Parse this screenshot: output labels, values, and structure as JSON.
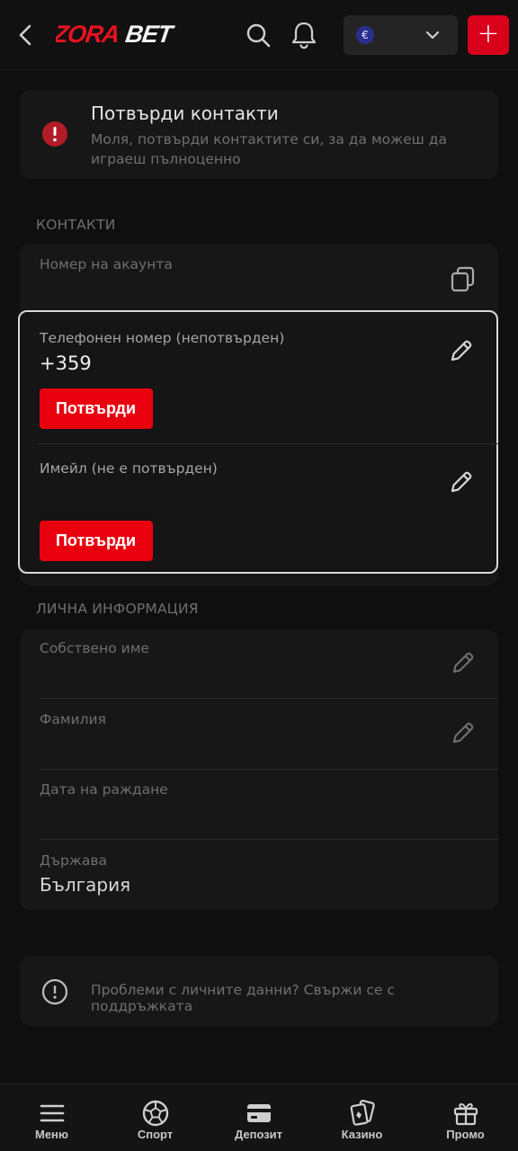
{
  "header": {
    "logo_text": "ZORABET",
    "currency_symbol": "€",
    "deposit_symbol": "+"
  },
  "alert": {
    "title": "Потвърди контакти",
    "text": "Моля, потвърди контактите си, за да можеш да играеш пълноценно"
  },
  "contacts": {
    "section_title": "КОНТАКТИ",
    "account_label": "Номер на акаунта",
    "phone_label": "Телефонен номер (непотвърден)",
    "phone_value": "+359",
    "phone_confirm": "Потвърди",
    "email_label": "Имейл (не е потвърден)",
    "email_confirm": "Потвърди"
  },
  "personal": {
    "section_title": "ЛИЧНА ИНФОРМАЦИЯ",
    "first_name_label": "Собствено име",
    "last_name_label": "Фамилия",
    "birthdate_label": "Дата на раждане",
    "country_label": "Държава",
    "country_value": "България"
  },
  "support": {
    "text": "Проблеми с личните данни? Свържи се с поддръжката"
  },
  "nav": {
    "items": [
      {
        "label": "Меню",
        "icon": "menu-icon"
      },
      {
        "label": "Спорт",
        "icon": "soccer-ball-icon"
      },
      {
        "label": "Депозит",
        "icon": "card-icon"
      },
      {
        "label": "Казино",
        "icon": "cards-icon"
      },
      {
        "label": "Промо",
        "icon": "gift-icon"
      }
    ]
  },
  "colors": {
    "accent": "#e8000f",
    "background": "#0f0f0f",
    "card": "#171717"
  }
}
